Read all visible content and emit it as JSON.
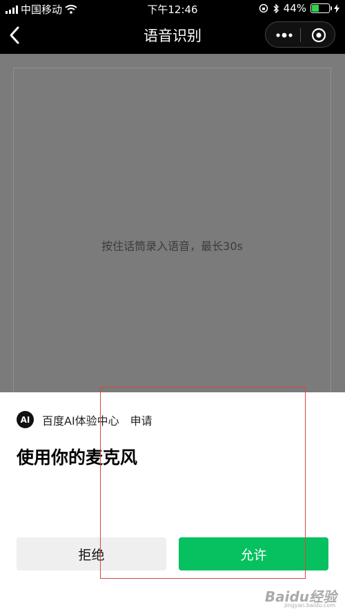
{
  "status_bar": {
    "carrier": "中国移动",
    "time": "下午12:46",
    "battery_percent": "44%",
    "battery_level": 0.44,
    "battery_color": "#2fd34b"
  },
  "nav": {
    "title": "语音识别",
    "icons": [
      "back-icon",
      "more-icon",
      "close-miniprogram-icon"
    ]
  },
  "content": {
    "hint": "按住话筒录入语音，最长30s",
    "overlay_color": "#7b7b7b"
  },
  "permission_sheet": {
    "app_logo": "AI",
    "app_name": "百度AI体验中心",
    "request_label": "申请",
    "title": "使用你的麦克风",
    "deny_label": "拒绝",
    "allow_label": "允许",
    "allow_color": "#07c160"
  },
  "annotation": {
    "color": "#d9453b"
  },
  "watermark": {
    "text": "Baidu经验",
    "sub": "jingyan.baidu.com"
  }
}
